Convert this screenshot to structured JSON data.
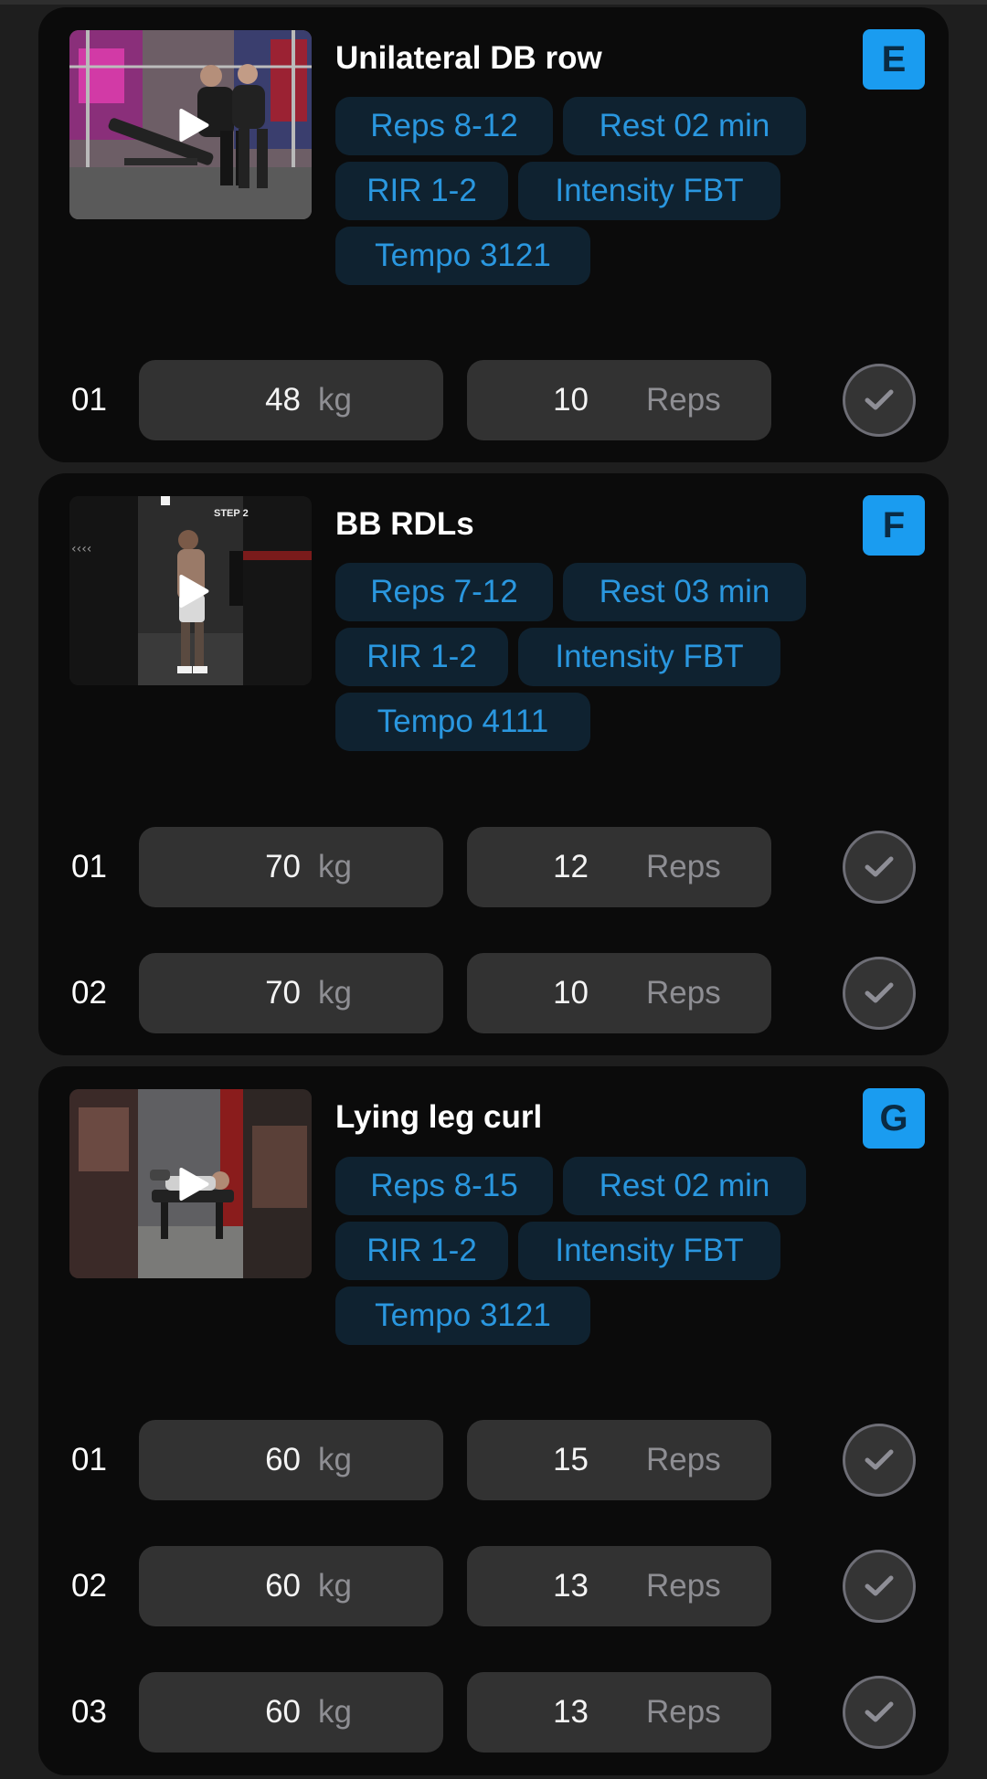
{
  "exercises": [
    {
      "name": "Unilateral DB row",
      "letter": "E",
      "tags": {
        "reps": "Reps 8-12",
        "rest": "Rest 02 min",
        "rir": "RIR 1-2",
        "intensity": "Intensity FBT",
        "tempo": "Tempo 3121"
      },
      "sets": [
        {
          "num": "01",
          "weight": "48",
          "weight_unit": "kg",
          "reps": "10",
          "reps_unit": "Reps"
        }
      ]
    },
    {
      "name": "BB RDLs",
      "letter": "F",
      "tags": {
        "reps": "Reps 7-12",
        "rest": "Rest 03 min",
        "rir": "RIR 1-2",
        "intensity": "Intensity FBT",
        "tempo": "Tempo 4111"
      },
      "sets": [
        {
          "num": "01",
          "weight": "70",
          "weight_unit": "kg",
          "reps": "12",
          "reps_unit": "Reps"
        },
        {
          "num": "02",
          "weight": "70",
          "weight_unit": "kg",
          "reps": "10",
          "reps_unit": "Reps"
        }
      ]
    },
    {
      "name": "Lying leg curl",
      "letter": "G",
      "tags": {
        "reps": "Reps 8-15",
        "rest": "Rest 02 min",
        "rir": "RIR 1-2",
        "intensity": "Intensity FBT",
        "tempo": "Tempo 3121"
      },
      "sets": [
        {
          "num": "01",
          "weight": "60",
          "weight_unit": "kg",
          "reps": "15",
          "reps_unit": "Reps"
        },
        {
          "num": "02",
          "weight": "60",
          "weight_unit": "kg",
          "reps": "13",
          "reps_unit": "Reps"
        },
        {
          "num": "03",
          "weight": "60",
          "weight_unit": "kg",
          "reps": "13",
          "reps_unit": "Reps"
        }
      ]
    }
  ],
  "thumbnail_labels": {
    "step": "STEP 2"
  },
  "icons": {
    "play": "play-icon",
    "check": "checkmark-icon"
  },
  "colors": {
    "accent": "#1a9cf0",
    "tag_text": "#2a97df",
    "tag_bg": "#0f2230",
    "card_bg": "#0b0b0b",
    "field_bg": "#323232",
    "page_bg": "#1e1e1e"
  }
}
